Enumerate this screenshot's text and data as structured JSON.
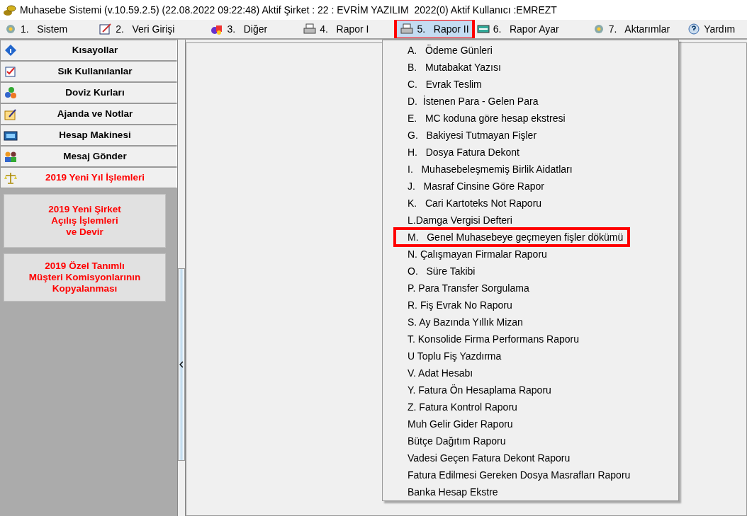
{
  "window": {
    "title": "Muhasebe Sistemi (v.10.59.2.5) (22.08.2022 09:22:48) Aktif Şirket : 22 : EVRİM YAZILIM  2022(0) Aktif Kullanıcı :EMREZT"
  },
  "menu": [
    {
      "label": "1.   Sistem",
      "selected": false,
      "highlighted": false
    },
    {
      "label": "2.   Veri Girişi",
      "selected": false,
      "highlighted": false
    },
    {
      "label": "3.   Diğer",
      "selected": false,
      "highlighted": false
    },
    {
      "label": "4.   Rapor I",
      "selected": false,
      "highlighted": false
    },
    {
      "label": "5.   Rapor II",
      "selected": true,
      "highlighted": true
    },
    {
      "label": "6.   Rapor Ayar",
      "selected": false,
      "highlighted": false
    },
    {
      "label": "7.   Aktarımlar",
      "selected": false,
      "highlighted": false
    },
    {
      "label": "Yardım",
      "selected": false,
      "highlighted": false
    }
  ],
  "sidebar": {
    "items": [
      {
        "label": "Kısayollar",
        "alert": false
      },
      {
        "label": "Sık Kullanılanlar",
        "alert": false
      },
      {
        "label": "Doviz Kurları",
        "alert": false
      },
      {
        "label": "Ajanda ve Notlar",
        "alert": false
      },
      {
        "label": "Hesap Makinesi",
        "alert": false
      },
      {
        "label": "Mesaj Gönder",
        "alert": false
      },
      {
        "label": "2019 Yeni Yıl İşlemleri",
        "alert": true
      }
    ],
    "buttons": [
      "2019 Yeni Şirket\nAçılış İşlemleri\nve Devir",
      "2019 Özel Tanımlı\nMüşteri Komisyonlarının\nKopyalanması"
    ]
  },
  "dropdown": {
    "items": [
      {
        "label": "A.   Ödeme Günleri",
        "highlighted": false
      },
      {
        "label": "B.   Mutabakat Yazısı",
        "highlighted": false
      },
      {
        "label": "C.   Evrak Teslim",
        "highlighted": false
      },
      {
        "label": "D.  İstenen Para - Gelen Para",
        "highlighted": false
      },
      {
        "label": "E.   MC koduna göre hesap ekstresi",
        "highlighted": false
      },
      {
        "label": "G.   Bakiyesi Tutmayan Fişler",
        "highlighted": false
      },
      {
        "label": "H.   Dosya Fatura Dekont",
        "highlighted": false
      },
      {
        "label": "I.   Muhasebeleşmemiş Birlik Aidatları",
        "highlighted": false
      },
      {
        "label": "J.   Masraf Cinsine Göre Rapor",
        "highlighted": false
      },
      {
        "label": "K.   Cari Kartoteks Not Raporu",
        "highlighted": false
      },
      {
        "label": "L.Damga Vergisi Defteri",
        "highlighted": false
      },
      {
        "label": "M.   Genel Muhasebeye geçmeyen fişler dökümü",
        "highlighted": true
      },
      {
        "label": "N. Çalışmayan Firmalar Raporu",
        "highlighted": false
      },
      {
        "label": "O.   Süre Takibi",
        "highlighted": false
      },
      {
        "label": "P. Para Transfer Sorgulama",
        "highlighted": false
      },
      {
        "label": "R. Fiş Evrak No Raporu",
        "highlighted": false
      },
      {
        "label": "S. Ay Bazında Yıllık Mizan",
        "highlighted": false
      },
      {
        "label": "T. Konsolide Firma Performans Raporu",
        "highlighted": false
      },
      {
        "label": "U Toplu Fiş Yazdırma",
        "highlighted": false
      },
      {
        "label": "V. Adat Hesabı",
        "highlighted": false
      },
      {
        "label": "Y. Fatura Ön Hesaplama Raporu",
        "highlighted": false
      },
      {
        "label": "Z. Fatura Kontrol Raporu",
        "highlighted": false
      },
      {
        "label": "Muh Gelir Gider Raporu",
        "highlighted": false
      },
      {
        "label": "Bütçe Dağıtım Raporu",
        "highlighted": false
      },
      {
        "label": "Vadesi Geçen Fatura Dekont Raporu",
        "highlighted": false
      },
      {
        "label": "Fatura Edilmesi Gereken Dosya Masrafları Raporu",
        "highlighted": false
      },
      {
        "label": "Banka Hesap Ekstre",
        "highlighted": false
      }
    ]
  }
}
